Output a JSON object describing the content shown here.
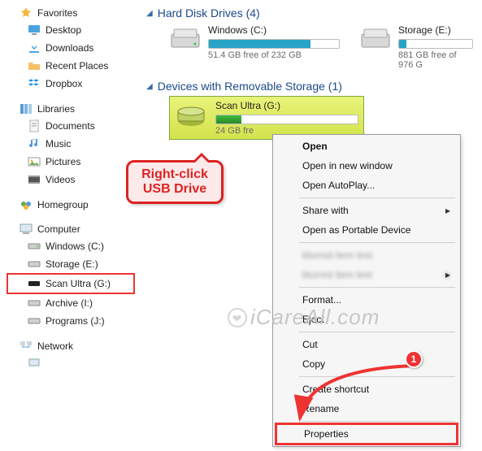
{
  "sidebar": {
    "favorites": {
      "label": "Favorites",
      "items": [
        "Desktop",
        "Downloads",
        "Recent Places",
        "Dropbox"
      ]
    },
    "libraries": {
      "label": "Libraries",
      "items": [
        "Documents",
        "Music",
        "Pictures",
        "Videos"
      ]
    },
    "homegroup": {
      "label": "Homegroup"
    },
    "computer": {
      "label": "Computer",
      "items": [
        {
          "label": "Windows (C:)"
        },
        {
          "label": "Storage (E:)"
        },
        {
          "label": "Scan Ultra (G:)"
        },
        {
          "label": "Archive (I:)"
        },
        {
          "label": "Programs (J:)"
        }
      ]
    },
    "network": {
      "label": "Network"
    }
  },
  "main": {
    "groups": {
      "hdd": {
        "label": "Hard Disk Drives (4)"
      },
      "removable": {
        "label": "Devices with Removable Storage (1)"
      }
    },
    "drives": {
      "c": {
        "name": "Windows (C:)",
        "free": "51.4 GB free of 232 GB",
        "used_pct": 78
      },
      "e": {
        "name": "Storage (E:)",
        "free": "881 GB free of 976 G",
        "used_pct": 10
      },
      "g": {
        "name": "Scan Ultra (G:)",
        "free": "24 GB fre",
        "used_pct": 18
      }
    }
  },
  "menu": {
    "open": "Open",
    "open_new": "Open in new window",
    "autoplay": "Open AutoPlay...",
    "share": "Share with",
    "share2": "Open as Portable Device",
    "format": "Format...",
    "eject": "Eject",
    "cut": "Cut",
    "copy": "Copy",
    "shortcut": "Create shortcut",
    "rename": "Rename",
    "properties": "Properties"
  },
  "callout": {
    "line1": "Right-click",
    "line2": "USB Drive"
  },
  "annotations": {
    "marker1": "1"
  },
  "watermark": "iCareAll.com"
}
